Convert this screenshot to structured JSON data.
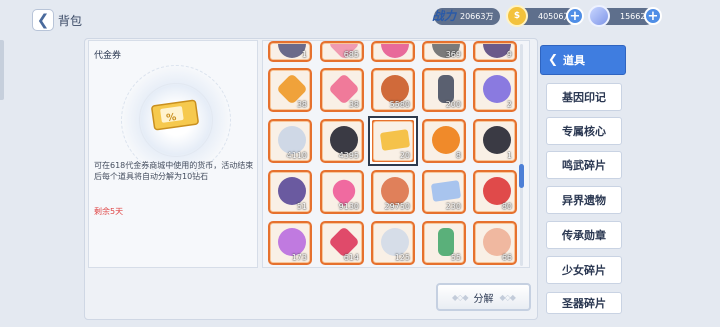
{
  "header": {
    "back_glyph": "❮",
    "title": "背包",
    "power": {
      "label": "战力",
      "value": "20663万"
    },
    "gold": {
      "value": "40506万",
      "icon": "gold-coin-icon"
    },
    "gems": {
      "value": "156628",
      "icon": "gem-icon"
    }
  },
  "detail": {
    "name": "代金券",
    "description": "可在618代金券商城中使用的货币，活动结束后每个道具将自动分解为10钻石",
    "remaining": "剩余5天"
  },
  "items": [
    {
      "count": "1",
      "icon": "ring-icon",
      "color": "#6b6b8a"
    },
    {
      "count": "685",
      "icon": "pink-crystal-icon",
      "color": "#f09ab0"
    },
    {
      "count": "",
      "icon": "ribbon-icon",
      "color": "#e86a9a"
    },
    {
      "count": "369",
      "icon": "gear-icon",
      "color": "#7a7a7a"
    },
    {
      "count": "9",
      "icon": "dark-shard-icon",
      "color": "#6a5a8a"
    },
    {
      "count": "38",
      "icon": "orange-gem-icon",
      "color": "#f0a23a"
    },
    {
      "count": "38",
      "icon": "pink-gem-icon",
      "color": "#f07a9a"
    },
    {
      "count": "5580",
      "icon": "star-medal-icon",
      "color": "#d06a3a"
    },
    {
      "count": "200",
      "icon": "capsule-icon",
      "color": "#5a6070"
    },
    {
      "count": "2",
      "icon": "purple-emblem-icon",
      "color": "#8a7ae0"
    },
    {
      "count": "4110",
      "icon": "ghost-icon",
      "color": "#cfd8e6"
    },
    {
      "count": "4395",
      "icon": "black-blob-icon",
      "color": "#3a3a44"
    },
    {
      "count": "20",
      "icon": "voucher-icon",
      "color": "#f5c24a"
    },
    {
      "count": "8",
      "icon": "flame-leaf-icon",
      "color": "#f08a2a"
    },
    {
      "count": "1",
      "icon": "shield-icon",
      "color": "#3a3a44"
    },
    {
      "count": "51",
      "icon": "gauntlet-icon",
      "color": "#6a5aa0"
    },
    {
      "count": "9130",
      "icon": "heart-icon",
      "color": "#f06aa0"
    },
    {
      "count": "29750",
      "icon": "coin-icon",
      "color": "#e0805a"
    },
    {
      "count": "230",
      "icon": "ticket-icon",
      "color": "#a8c4ee"
    },
    {
      "count": "80",
      "icon": "candy-cane-icon",
      "color": "#e04a4a"
    },
    {
      "count": "173",
      "icon": "feather-icon",
      "color": "#c07ae0"
    },
    {
      "count": "614",
      "icon": "red-crystal-icon",
      "color": "#e04a6a"
    },
    {
      "count": "125",
      "icon": "cloud-icon",
      "color": "#d6dde8"
    },
    {
      "count": "55",
      "icon": "bottle-icon",
      "color": "#5ab07a"
    },
    {
      "count": "66",
      "icon": "bandage-icon",
      "color": "#f0b8a0"
    }
  ],
  "decompose_label": "分解",
  "menu": [
    {
      "label": "道具",
      "active": true
    },
    {
      "label": "基因印记",
      "active": false
    },
    {
      "label": "专属核心",
      "active": false
    },
    {
      "label": "鸣武碎片",
      "active": false
    },
    {
      "label": "异界遗物",
      "active": false
    },
    {
      "label": "传承勋章",
      "active": false
    },
    {
      "label": "少女碎片",
      "active": false
    },
    {
      "label": "圣器碎片",
      "active": false
    }
  ]
}
